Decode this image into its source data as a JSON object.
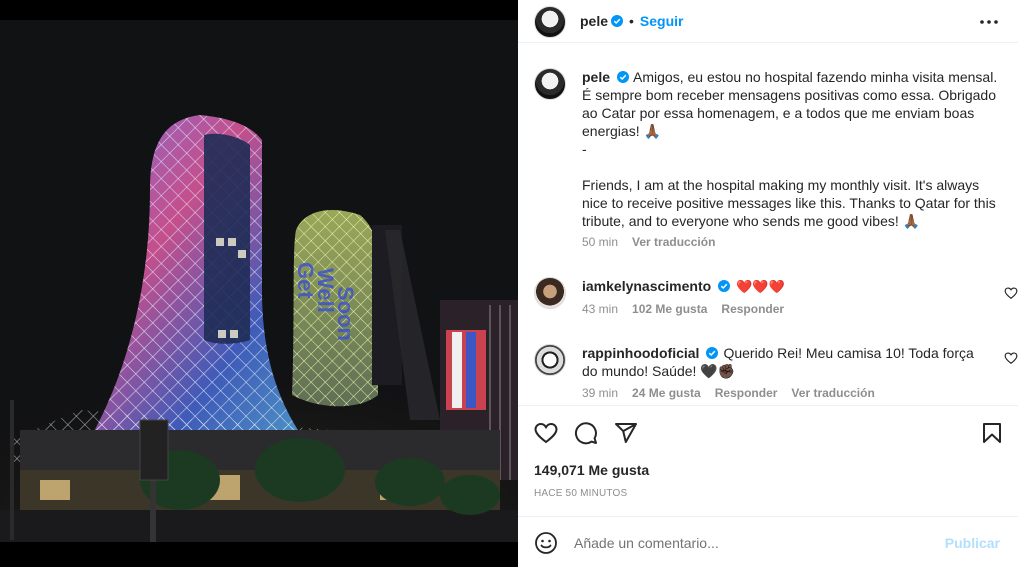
{
  "photo": {
    "alt": "Photo"
  },
  "header": {
    "username": "pele",
    "separator": "•",
    "follow_label": "Seguir"
  },
  "caption": {
    "username": "pele",
    "text_pt": "Amigos, eu estou no hospital fazendo minha visita mensal. É sempre bom receber mensagens positivas como essa. Obrigado ao Catar por essa homenagem, e a todos que me enviam boas energias! 🙏🏾",
    "dash": "-",
    "text_en": "Friends, I am at the hospital making my monthly visit. It's always nice to receive positive messages like this. Thanks to Qatar for this tribute, and to everyone who sends me good vibes! 🙏🏾",
    "time": "50 min",
    "translate_label": "Ver traducción"
  },
  "comments": [
    {
      "username": "iamkelynascimento",
      "text": "❤️❤️❤️",
      "time": "43 min",
      "likes": "102 Me gusta",
      "reply_label": "Responder"
    },
    {
      "username": "rappinhoodoficial",
      "text": "Querido Rei! Meu camisa 10! Toda força do mundo! Saúde! 🖤✊🏿",
      "time": "39 min",
      "likes": "24 Me gusta",
      "reply_label": "Responder",
      "translate_label": "Ver traducción"
    }
  ],
  "actions": {
    "like_icon": "heart-icon",
    "comment_icon": "comment-icon",
    "share_icon": "share-icon",
    "save_icon": "bookmark-icon"
  },
  "likes": "149,071 Me gusta",
  "posted": "HACE 50 MINUTOS",
  "comment_box": {
    "placeholder": "Añade un comentario...",
    "publish_label": "Publicar"
  },
  "colors": {
    "accent": "#0095f6",
    "publish_disabled": "#b2dffc",
    "muted": "#8e8e8e",
    "heart_red": "#ed4956"
  }
}
